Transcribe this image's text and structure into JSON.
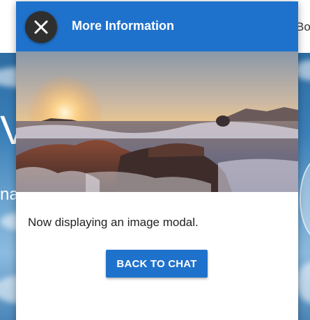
{
  "background": {
    "topbar_text": "Bo",
    "hero_text_1": "V",
    "hero_text_2": "na"
  },
  "modal": {
    "title": "More Information",
    "close_icon": "close-icon",
    "image_description_icon": "sunset-ocean-photo",
    "body_text": "Now displaying an image modal.",
    "back_button_label": "BACK TO CHAT"
  },
  "colors": {
    "header": "#1f72cc",
    "button": "#1f72cc",
    "close_button": "#2f2f2f"
  }
}
